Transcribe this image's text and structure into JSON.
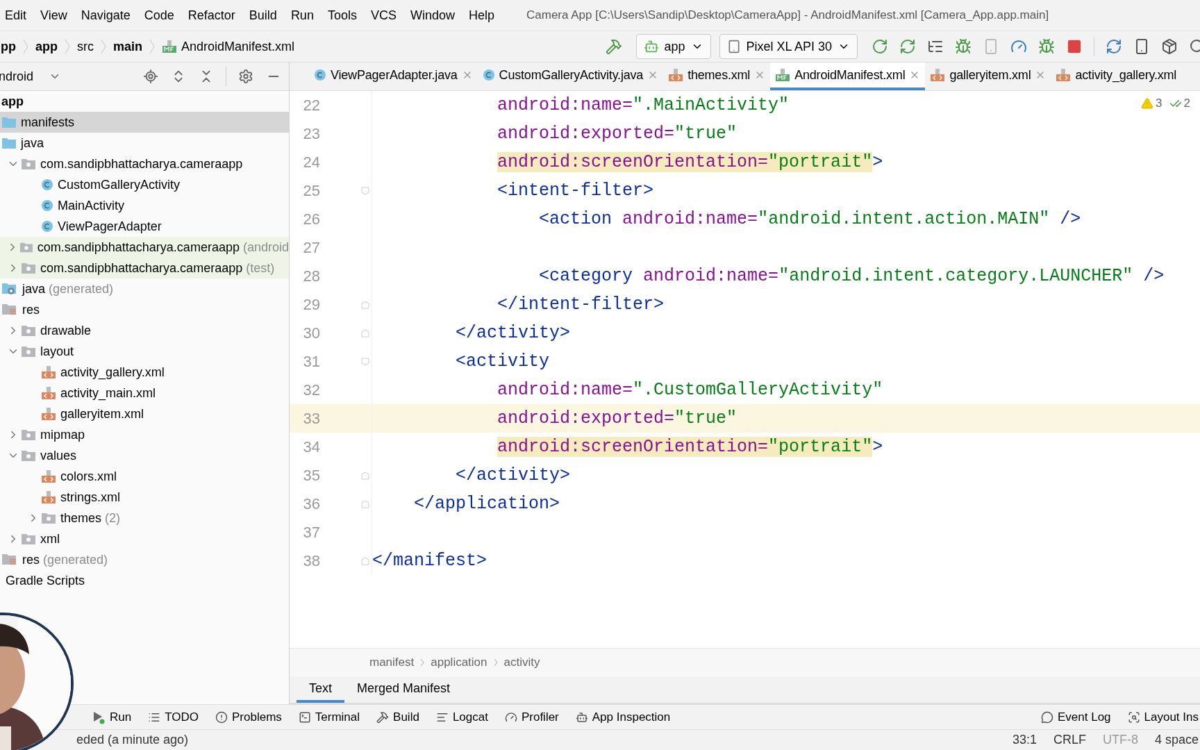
{
  "menu": [
    "Edit",
    "View",
    "Navigate",
    "Code",
    "Refactor",
    "Build",
    "Run",
    "Tools",
    "VCS",
    "Window",
    "Help"
  ],
  "window": {
    "title": "Camera App [C:\\Users\\Sandip\\Desktop\\CameraApp] - AndroidManifest.xml [Camera_App.app.main]"
  },
  "breadcrumb": [
    {
      "label": "pp",
      "bold": true,
      "kind": "text"
    },
    {
      "label": "app",
      "bold": true,
      "kind": "text"
    },
    {
      "label": "src",
      "bold": false,
      "kind": "text"
    },
    {
      "label": "main",
      "bold": true,
      "kind": "text"
    },
    {
      "label": "AndroidManifest.xml",
      "bold": false,
      "kind": "manifest"
    }
  ],
  "run_config": {
    "module": "app",
    "device": "Pixel XL API 30"
  },
  "project_view": {
    "mode": "ndroid"
  },
  "tree": [
    {
      "label": "app",
      "kind": "root",
      "children": [
        {
          "label": "manifests",
          "kind": "folder",
          "selected": true,
          "tinted": false
        },
        {
          "label": "java",
          "kind": "folder",
          "selected": false,
          "tinted": false,
          "children": [
            {
              "label": "com.sandipbhattacharya.cameraapp",
              "kind": "package",
              "selected": false,
              "tinted": false,
              "expanded": true,
              "children": [
                {
                  "label": "CustomGalleryActivity",
                  "kind": "class",
                  "selected": false,
                  "tinted": false
                },
                {
                  "label": "MainActivity",
                  "kind": "class",
                  "selected": false,
                  "tinted": false
                },
                {
                  "label": "ViewPagerAdapter",
                  "kind": "class",
                  "selected": false,
                  "tinted": false
                }
              ]
            },
            {
              "label": "com.sandipbhattacharya.cameraapp",
              "note": "(android",
              "kind": "package",
              "selected": false,
              "tinted": true,
              "expanded": false
            },
            {
              "label": "com.sandipbhattacharya.cameraapp",
              "note": "(test)",
              "kind": "package",
              "selected": false,
              "tinted": true,
              "expanded": false
            }
          ]
        },
        {
          "label": "java",
          "note": "(generated)",
          "kind": "generated",
          "selected": false,
          "tinted": false
        },
        {
          "label": "res",
          "kind": "res",
          "selected": false,
          "tinted": false,
          "children": [
            {
              "label": "drawable",
              "kind": "package",
              "selected": false,
              "tinted": false,
              "expanded": false
            },
            {
              "label": "layout",
              "kind": "package",
              "selected": false,
              "tinted": false,
              "expanded": true,
              "children": [
                {
                  "label": "activity_gallery.xml",
                  "kind": "xml",
                  "selected": false,
                  "tinted": false
                },
                {
                  "label": "activity_main.xml",
                  "kind": "xml",
                  "selected": false,
                  "tinted": false
                },
                {
                  "label": "galleryitem.xml",
                  "kind": "xml",
                  "selected": false,
                  "tinted": false
                }
              ]
            },
            {
              "label": "mipmap",
              "kind": "package",
              "selected": false,
              "tinted": false,
              "expanded": false
            },
            {
              "label": "values",
              "kind": "package",
              "selected": false,
              "tinted": false,
              "expanded": true,
              "children": [
                {
                  "label": "colors.xml",
                  "kind": "xml",
                  "selected": false,
                  "tinted": false
                },
                {
                  "label": "strings.xml",
                  "kind": "xml",
                  "selected": false,
                  "tinted": false
                },
                {
                  "label": "themes",
                  "note": "(2)",
                  "kind": "package",
                  "selected": false,
                  "tinted": false,
                  "expanded": false
                }
              ]
            },
            {
              "label": "xml",
              "kind": "package",
              "selected": false,
              "tinted": false,
              "expanded": false
            }
          ]
        },
        {
          "label": "res",
          "note": "(generated)",
          "kind": "res",
          "selected": false,
          "tinted": false
        },
        {
          "label": "Gradle Scripts",
          "kind": "plain",
          "selected": false,
          "tinted": false
        }
      ]
    }
  ],
  "tabs": [
    {
      "label": "ViewPagerAdapter.java",
      "kind": "class",
      "selected": false
    },
    {
      "label": "CustomGalleryActivity.java",
      "kind": "class",
      "selected": false
    },
    {
      "label": "themes.xml",
      "kind": "xml",
      "selected": false
    },
    {
      "label": "AndroidManifest.xml",
      "kind": "manifest",
      "selected": true
    },
    {
      "label": "galleryitem.xml",
      "kind": "xml",
      "selected": false
    },
    {
      "label": "activity_gallery.xml",
      "kind": "xml",
      "selected": false
    }
  ],
  "inspections": {
    "warnings": "3",
    "passed": "2"
  },
  "code": [
    {
      "number": "22",
      "kind": "plain",
      "current": false,
      "tokens": [
        {
          "kind": "attr",
          "text": "            android:name=",
          "warning": false
        },
        {
          "kind": "value",
          "text": "\".MainActivity\"",
          "warning": false
        }
      ]
    },
    {
      "number": "23",
      "kind": "plain",
      "current": false,
      "tokens": [
        {
          "kind": "attr",
          "text": "            android:exported=",
          "warning": false
        },
        {
          "kind": "value",
          "text": "\"true\"",
          "warning": false
        }
      ]
    },
    {
      "number": "24",
      "kind": "plain",
      "current": false,
      "tokens": [
        {
          "kind": "attr",
          "text": "            android:screenOrientation=",
          "warning": true
        },
        {
          "kind": "value",
          "text": "\"portrait\"",
          "warning": true
        },
        {
          "kind": "tag",
          "text": ">",
          "warning": false
        }
      ]
    },
    {
      "number": "25",
      "kind": "open",
      "current": false,
      "tokens": [
        {
          "kind": "tag",
          "text": "            <intent-filter>",
          "warning": false
        }
      ]
    },
    {
      "number": "26",
      "kind": "plain",
      "current": false,
      "tokens": [
        {
          "kind": "tag",
          "text": "                <action ",
          "warning": false
        },
        {
          "kind": "attr",
          "text": "android:name=",
          "warning": false
        },
        {
          "kind": "value",
          "text": "\"android.intent.action.MAIN\"",
          "warning": false
        },
        {
          "kind": "tag",
          "text": " />",
          "warning": false
        }
      ]
    },
    {
      "number": "27",
      "kind": "plain",
      "current": false
    },
    {
      "number": "28",
      "kind": "plain",
      "current": false,
      "tokens": [
        {
          "kind": "tag",
          "text": "                <category ",
          "warning": false
        },
        {
          "kind": "attr",
          "text": "android:name=",
          "warning": false
        },
        {
          "kind": "value",
          "text": "\"android.intent.category.LAUNCHER\"",
          "warning": false
        },
        {
          "kind": "tag",
          "text": " />",
          "warning": false
        }
      ]
    },
    {
      "number": "29",
      "kind": "close",
      "current": false,
      "tokens": [
        {
          "kind": "tag",
          "text": "            </intent-filter>",
          "warning": false
        }
      ]
    },
    {
      "number": "30",
      "kind": "close",
      "current": false,
      "tokens": [
        {
          "kind": "tag",
          "text": "        </activity>",
          "warning": false
        }
      ]
    },
    {
      "number": "31",
      "kind": "open",
      "current": false,
      "tokens": [
        {
          "kind": "tag",
          "text": "        <activity",
          "warning": false
        }
      ]
    },
    {
      "number": "32",
      "kind": "plain",
      "current": false,
      "tokens": [
        {
          "kind": "attr",
          "text": "            android:name=",
          "warning": false
        },
        {
          "kind": "value",
          "text": "\".CustomGalleryActivity\"",
          "warning": false
        }
      ]
    },
    {
      "number": "33",
      "kind": "plain",
      "current": true,
      "tokens": [
        {
          "kind": "attr",
          "text": "            android:exported=",
          "warning": false
        },
        {
          "kind": "value",
          "text": "\"true\"",
          "warning": false
        }
      ]
    },
    {
      "number": "34",
      "kind": "plain",
      "current": false,
      "tokens": [
        {
          "kind": "attr",
          "text": "            android:screenOrientation=",
          "warning": true
        },
        {
          "kind": "value",
          "text": "\"portrait\"",
          "warning": true
        },
        {
          "kind": "tag",
          "text": ">",
          "warning": false
        }
      ]
    },
    {
      "number": "35",
      "kind": "close",
      "current": false,
      "tokens": [
        {
          "kind": "tag",
          "text": "        </activity>",
          "warning": false
        }
      ]
    },
    {
      "number": "36",
      "kind": "close",
      "current": false,
      "tokens": [
        {
          "kind": "tag",
          "text": "    </application>",
          "warning": false
        }
      ]
    },
    {
      "number": "37",
      "kind": "plain",
      "current": false
    },
    {
      "number": "38",
      "kind": "close",
      "current": false,
      "tokens": [
        {
          "kind": "tag",
          "text": "</manifest>",
          "warning": false
        }
      ]
    }
  ],
  "editor_breadcrumb": [
    "manifest",
    "application",
    "activity"
  ],
  "editor_tabs": [
    {
      "label": "Text",
      "selected": true
    },
    {
      "label": "Merged Manifest",
      "selected": false
    }
  ],
  "tool_windows_left": [
    {
      "label": "Run",
      "kind": "run"
    },
    {
      "label": "TODO",
      "kind": "todo"
    },
    {
      "label": "Problems",
      "kind": "problems"
    },
    {
      "label": "Terminal",
      "kind": "terminal"
    },
    {
      "label": "Build",
      "kind": "build"
    },
    {
      "label": "Logcat",
      "kind": "logcat"
    },
    {
      "label": "Profiler",
      "kind": "profiler"
    },
    {
      "label": "App Inspection",
      "kind": "inspection"
    }
  ],
  "tool_windows_right": [
    {
      "label": "Event Log",
      "kind": "eventlog"
    },
    {
      "label": "Layout Ins",
      "kind": "layout"
    }
  ],
  "status_bar": {
    "message": "eded (a minute ago)",
    "position": "33:1",
    "line_separator": "CRLF",
    "encoding": "UTF-8",
    "indent": "4 space"
  },
  "webcam": {
    "kind": "picture"
  }
}
